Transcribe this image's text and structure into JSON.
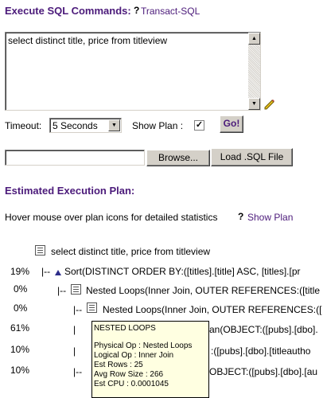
{
  "header": {
    "title": "Execute SQL Commands:",
    "help_link": "Transact-SQL"
  },
  "sql": {
    "text": "select distinct title, price from titleview"
  },
  "options": {
    "timeout_label": "Timeout:",
    "timeout_value": "5 Seconds",
    "show_plan_label": "Show Plan :",
    "show_plan_checked": "✓",
    "go_label": "Go!"
  },
  "file": {
    "browse_label": "Browse...",
    "load_label": "Load .SQL File"
  },
  "plan": {
    "title": "Estimated Execution Plan:",
    "hint": "Hover mouse over plan icons for detailed statistics",
    "show_plan_link": "Show Plan",
    "root_text": "select distinct title, price from titleview",
    "rows": [
      {
        "pct": "19%",
        "prefix": "|--",
        "text": "Sort(DISTINCT ORDER BY:([titles].[title] ASC, [titles].[pr"
      },
      {
        "pct": "0%",
        "prefix": "|--",
        "text": "Nested Loops(Inner Join, OUTER REFERENCES:([title"
      },
      {
        "pct": "0%",
        "prefix": "|--",
        "text": "Nested Loops(Inner Join, OUTER REFERENCES:(["
      },
      {
        "pct": "61%",
        "prefix": "|",
        "text": "an(OBJECT:([pubs].[dbo]."
      },
      {
        "pct": "10%",
        "prefix": "|",
        "text": ":([pubs].[dbo].[titleautho"
      },
      {
        "pct": "10%",
        "prefix": "|--",
        "text": "OBJECT:([pubs].[dbo].[au"
      }
    ]
  },
  "tooltip": {
    "title": "NESTED LOOPS",
    "lines": [
      "Physical Op : Nested Loops",
      "Logical Op : Inner Join",
      "Est Rows : 25",
      "Avg Row Size : 266",
      "Est CPU : 0.0001045"
    ]
  }
}
